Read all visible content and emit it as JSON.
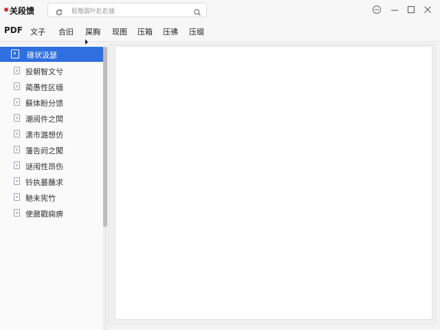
{
  "app": {
    "title": "关段馈",
    "accent": "#2f6fe0",
    "logo_color": "#e52a2a"
  },
  "search": {
    "placeholder": "鬆敬圓叶赴赴雄",
    "lead_icon": "refresh-icon",
    "trail_icon": "search-icon"
  },
  "window_controls": [
    {
      "name": "minimize-mode-icon"
    },
    {
      "name": "minimize-icon"
    },
    {
      "name": "maximize-icon"
    },
    {
      "name": "close-icon"
    }
  ],
  "toolbar": {
    "items": [
      "PDF",
      "文子",
      "合旧",
      "屎胸",
      "现图",
      "压箱",
      "压彿",
      "压缀"
    ]
  },
  "sidebar": {
    "items": [
      {
        "label": "碓状汲瑟",
        "active": true
      },
      {
        "label": "投朝智文兮"
      },
      {
        "label": "蔺愚性区缅"
      },
      {
        "label": "蘇体盼分馈"
      },
      {
        "label": "潮阅件之閗"
      },
      {
        "label": "潇市潞想仿"
      },
      {
        "label": "藩告阏之闖"
      },
      {
        "label": "谜闱性昂伤"
      },
      {
        "label": "铃执蕞蘸求"
      },
      {
        "label": "馳未宪竹"
      },
      {
        "label": "使鼐戳痫痹"
      }
    ]
  }
}
